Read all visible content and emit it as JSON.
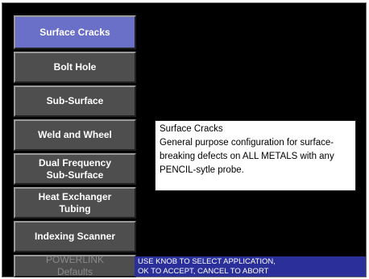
{
  "menu": {
    "items": [
      {
        "label": "Surface Cracks"
      },
      {
        "label": "Bolt Hole"
      },
      {
        "label": "Sub-Surface"
      },
      {
        "label": "Weld and Wheel"
      },
      {
        "label": "Dual Frequency\nSub-Surface"
      },
      {
        "label": "Heat Exchanger\nTubing"
      },
      {
        "label": "Indexing Scanner"
      },
      {
        "label": "POWERLINK\nDefaults"
      }
    ]
  },
  "info": {
    "title": "Surface Cracks",
    "description": "General purpose configuration for surface-breaking defects on ALL METALS with any PENCIL-sytle probe."
  },
  "status": {
    "text": "USE KNOB TO SELECT APPLICATION,\nOK TO ACCEPT, CANCEL TO ABORT"
  },
  "colors": {
    "selected_item": "#6a6fc8",
    "menu_item": "#4e4e4e",
    "status_bar": "#2a2f9a",
    "background": "#000000"
  }
}
